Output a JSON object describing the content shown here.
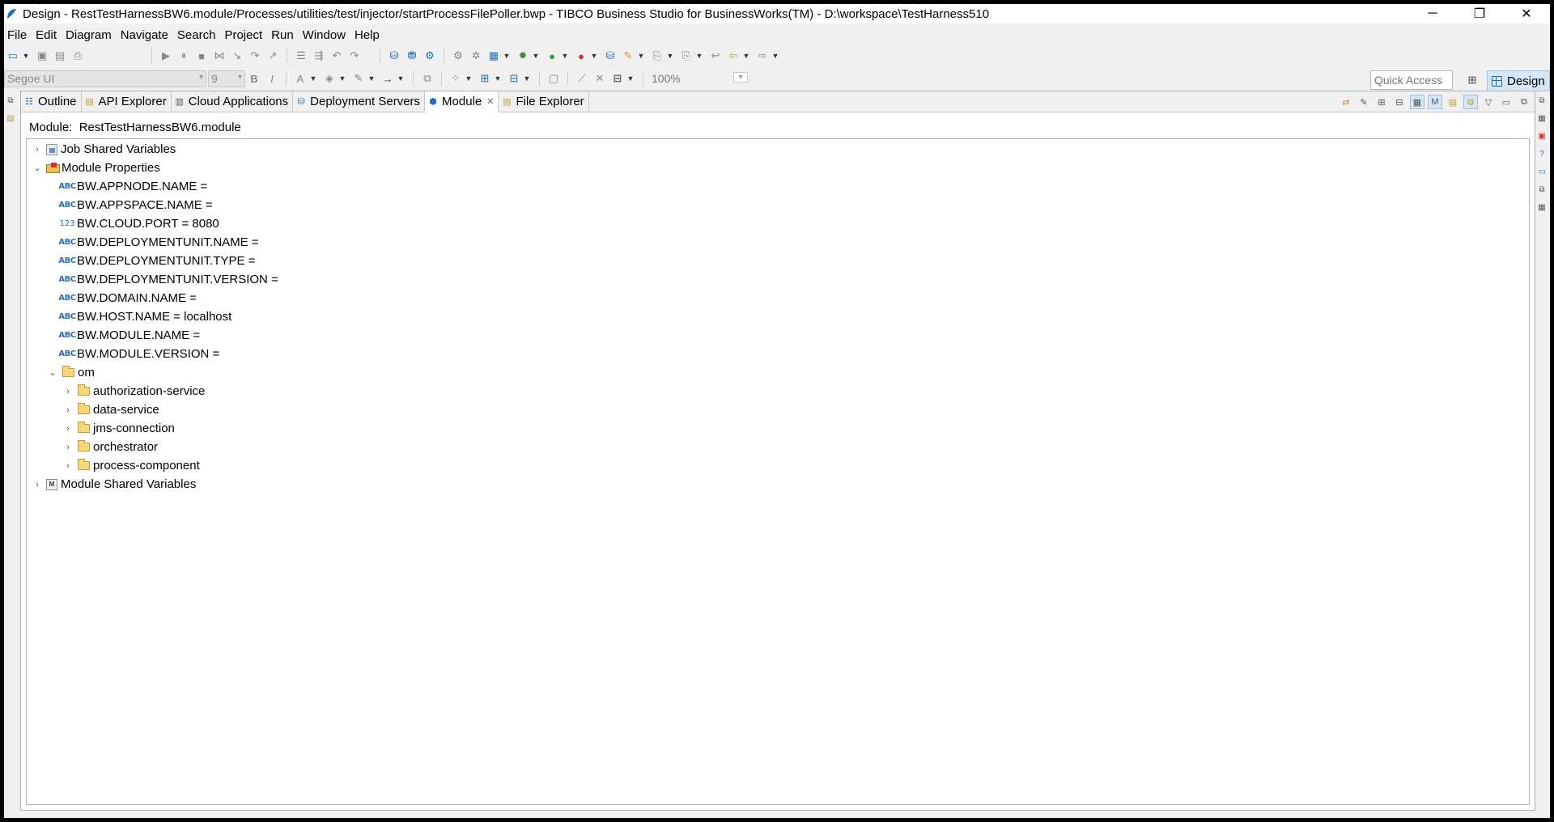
{
  "window": {
    "title": "Design - RestTestHarnessBW6.module/Processes/utilities/test/injector/startProcessFilePoller.bwp - TIBCO Business Studio for BusinessWorks(TM) - D:\\workspace\\TestHarness510",
    "minimize": "─",
    "restore": "❐",
    "close": "✕"
  },
  "menu": [
    "File",
    "Edit",
    "Diagram",
    "Navigate",
    "Search",
    "Project",
    "Run",
    "Window",
    "Help"
  ],
  "format_toolbar": {
    "font": "Segoe UI",
    "size": "9",
    "zoom": "100%"
  },
  "quick_access": "Quick Access",
  "perspective": "Design",
  "tabs": [
    {
      "label": "Outline",
      "icon": "outline-icon"
    },
    {
      "label": "API Explorer",
      "icon": "api-explorer-icon"
    },
    {
      "label": "Cloud Applications",
      "icon": "cloud-applications-icon"
    },
    {
      "label": "Deployment Servers",
      "icon": "deployment-servers-icon"
    },
    {
      "label": "Module",
      "icon": "module-icon",
      "selected": true,
      "closable": true
    },
    {
      "label": "File Explorer",
      "icon": "file-explorer-icon"
    }
  ],
  "module_header": "Module:  RestTestHarnessBW6.module",
  "tree": [
    {
      "label": "Job Shared Variables",
      "twisty": "›",
      "icon": "job-shared-variables-icon"
    },
    {
      "label": "Module Properties",
      "twisty": "⌄",
      "icon": "module-properties-icon"
    },
    {
      "label": "BW.APPNODE.NAME =",
      "badge": "ABC"
    },
    {
      "label": "BW.APPSPACE.NAME =",
      "badge": "ABC"
    },
    {
      "label": "BW.CLOUD.PORT = 8080",
      "badge": "123"
    },
    {
      "label": "BW.DEPLOYMENTUNIT.NAME =",
      "badge": "ABC"
    },
    {
      "label": "BW.DEPLOYMENTUNIT.TYPE =",
      "badge": "ABC"
    },
    {
      "label": "BW.DEPLOYMENTUNIT.VERSION =",
      "badge": "ABC"
    },
    {
      "label": "BW.DOMAIN.NAME =",
      "badge": "ABC"
    },
    {
      "label": "BW.HOST.NAME = localhost",
      "badge": "ABC"
    },
    {
      "label": "BW.MODULE.NAME =",
      "badge": "ABC"
    },
    {
      "label": "BW.MODULE.VERSION =",
      "badge": "ABC"
    },
    {
      "label": "om",
      "twisty": "⌄",
      "icon": "folder-icon"
    },
    {
      "label": "authorization-service",
      "twisty": "›",
      "icon": "folder-icon"
    },
    {
      "label": "data-service",
      "twisty": "›",
      "icon": "folder-icon"
    },
    {
      "label": "jms-connection",
      "twisty": "›",
      "icon": "folder-icon"
    },
    {
      "label": "orchestrator",
      "twisty": "›",
      "icon": "folder-icon"
    },
    {
      "label": "process-component",
      "twisty": "›",
      "icon": "folder-icon"
    },
    {
      "label": "Module Shared Variables",
      "twisty": "›",
      "icon": "module-shared-variables-icon",
      "icon_letter": "M"
    }
  ],
  "colors": {
    "accent": "#1f6fb8",
    "selected_perspective": "#d6e6f5",
    "property_badge": "#2c6fb3"
  }
}
